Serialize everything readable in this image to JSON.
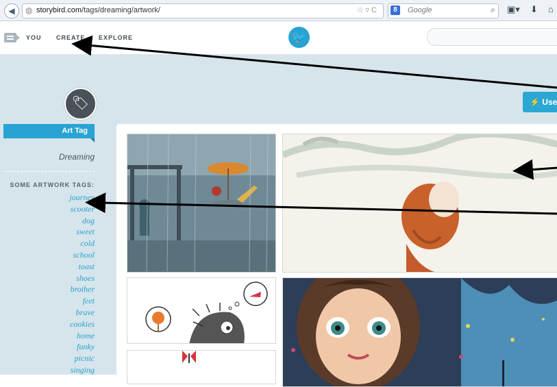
{
  "browser": {
    "url_domain": "storybird.com",
    "url_path": "/tags/dreaming/artwork/",
    "search_placeholder": "Google",
    "search_engine_badge": "8",
    "icons": [
      "back-icon",
      "globe-icon",
      "star-icon",
      "dropdown-icon",
      "reload-icon",
      "search-icon",
      "bookmark-icon",
      "download-icon",
      "home-icon"
    ]
  },
  "header": {
    "nav": [
      "YOU",
      "CREATE",
      "EXPLORE"
    ],
    "logo": "bird-logo"
  },
  "sidebar": {
    "section_label": "Art Tag",
    "current_tag": "Dreaming",
    "tags_heading": "SOME ARTWORK TAGS:",
    "tags": [
      "journey",
      "scooter",
      "dog",
      "sweet",
      "cold",
      "school",
      "toast",
      "shoes",
      "brother",
      "feet",
      "brave",
      "cookies",
      "home",
      "funky",
      "picnic",
      "singing"
    ]
  },
  "main": {
    "use_button_label": "Use",
    "artworks": [
      "rainy-cafe-illustration",
      "girl-looking-up-illustration",
      "hedgehog-dreaming-illustration",
      "big-eyed-girl-illustration",
      "butterfly-illustration"
    ]
  },
  "colors": {
    "accent": "#29a3d4",
    "background": "#d5e5eb",
    "arrow": "#000000"
  }
}
